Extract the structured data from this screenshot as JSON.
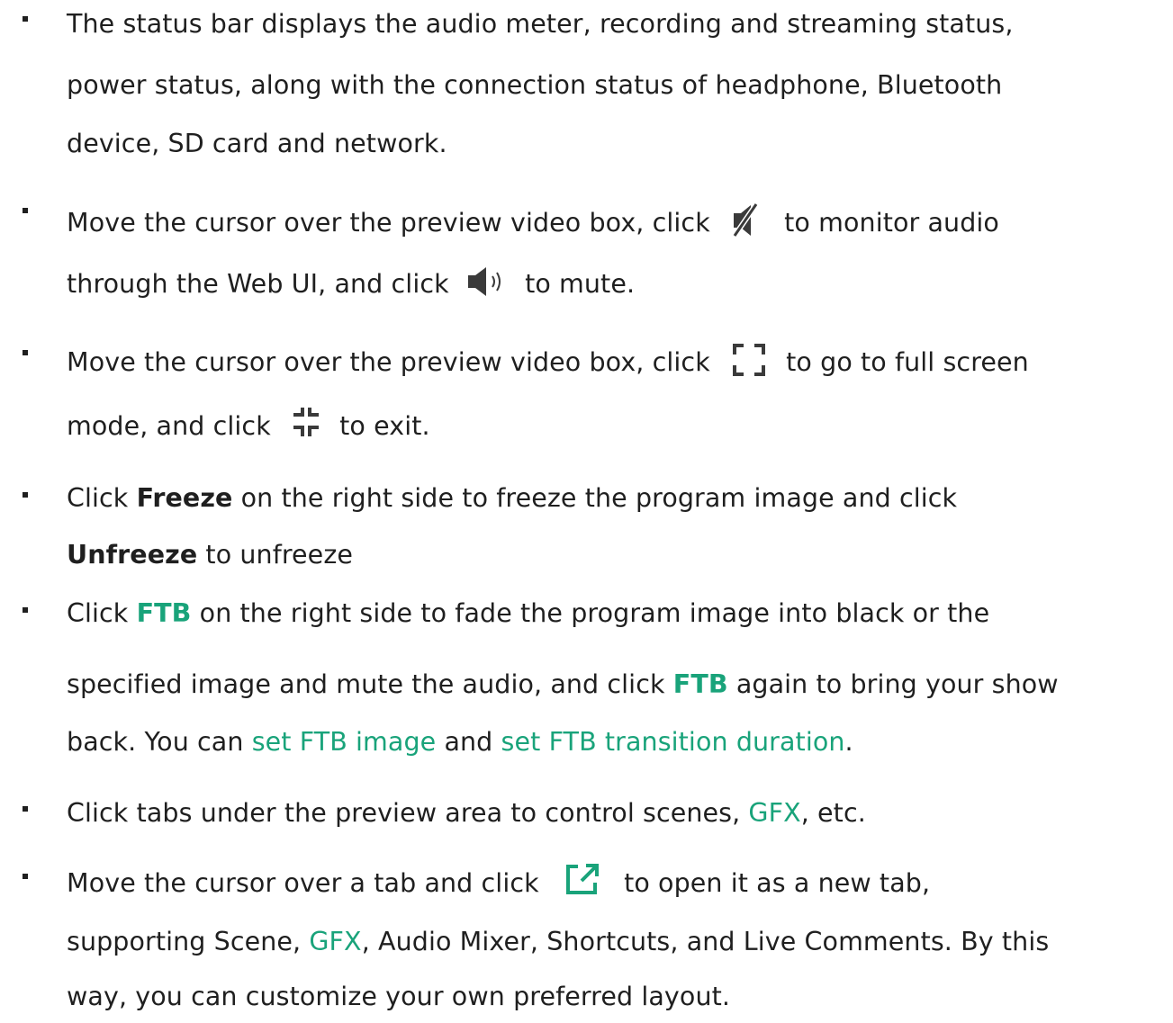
{
  "bullets": [
    {
      "lines": [
        "The status bar displays the audio meter, recording and streaming status,",
        "power status, along with the connection status of headphone, Bluetooth",
        "device, SD card and network."
      ]
    },
    {
      "line1_pre": "Move the cursor over the preview video box, click",
      "line1_post": "to monitor audio",
      "line2_pre": "through the Web UI, and click",
      "line2_post": "to mute.",
      "icons": [
        "speaker-muted-icon",
        "speaker-on-icon"
      ]
    },
    {
      "line1_pre": "Move the cursor over the preview video box, click",
      "line1_post": "to go to full screen",
      "line2_pre": "mode, and click",
      "line2_post": "to exit.",
      "icons": [
        "fullscreen-enter-icon",
        "fullscreen-exit-icon"
      ]
    },
    {
      "line1_a": "Click ",
      "line1_bold": "Freeze",
      "line1_b": " on the right side to freeze the program image and click",
      "line2_bold": "Unfreeze",
      "line2_b": " to unfreeze"
    },
    {
      "line1_a": "Click ",
      "line1_ftb": "FTB",
      "line1_b": " on the right side to fade the program image into black or the",
      "line2_a": "specified image and mute the audio, and click ",
      "line2_ftb": "FTB",
      "line2_b": " again to bring your show",
      "line3_a": "back. You can ",
      "line3_link1": "set FTB image",
      "line3_b": " and ",
      "line3_link2": "set FTB transition duration",
      "line3_c": "."
    },
    {
      "line1_a": "Click tabs under the preview area to control scenes, ",
      "line1_link": "GFX",
      "line1_b": ", etc."
    },
    {
      "line1_pre": "Move the cursor over a tab and click",
      "line1_post": "to open it as a new tab,",
      "line2_a": "supporting Scene, ",
      "line2_link": "GFX",
      "line2_b": ", Audio Mixer, Shortcuts, and Live Comments. By this",
      "line3": "way, you can customize your own preferred layout.",
      "icons": [
        "open-new-tab-icon"
      ]
    }
  ],
  "colors": {
    "text": "#1f1f1f",
    "link": "#19a37a"
  }
}
